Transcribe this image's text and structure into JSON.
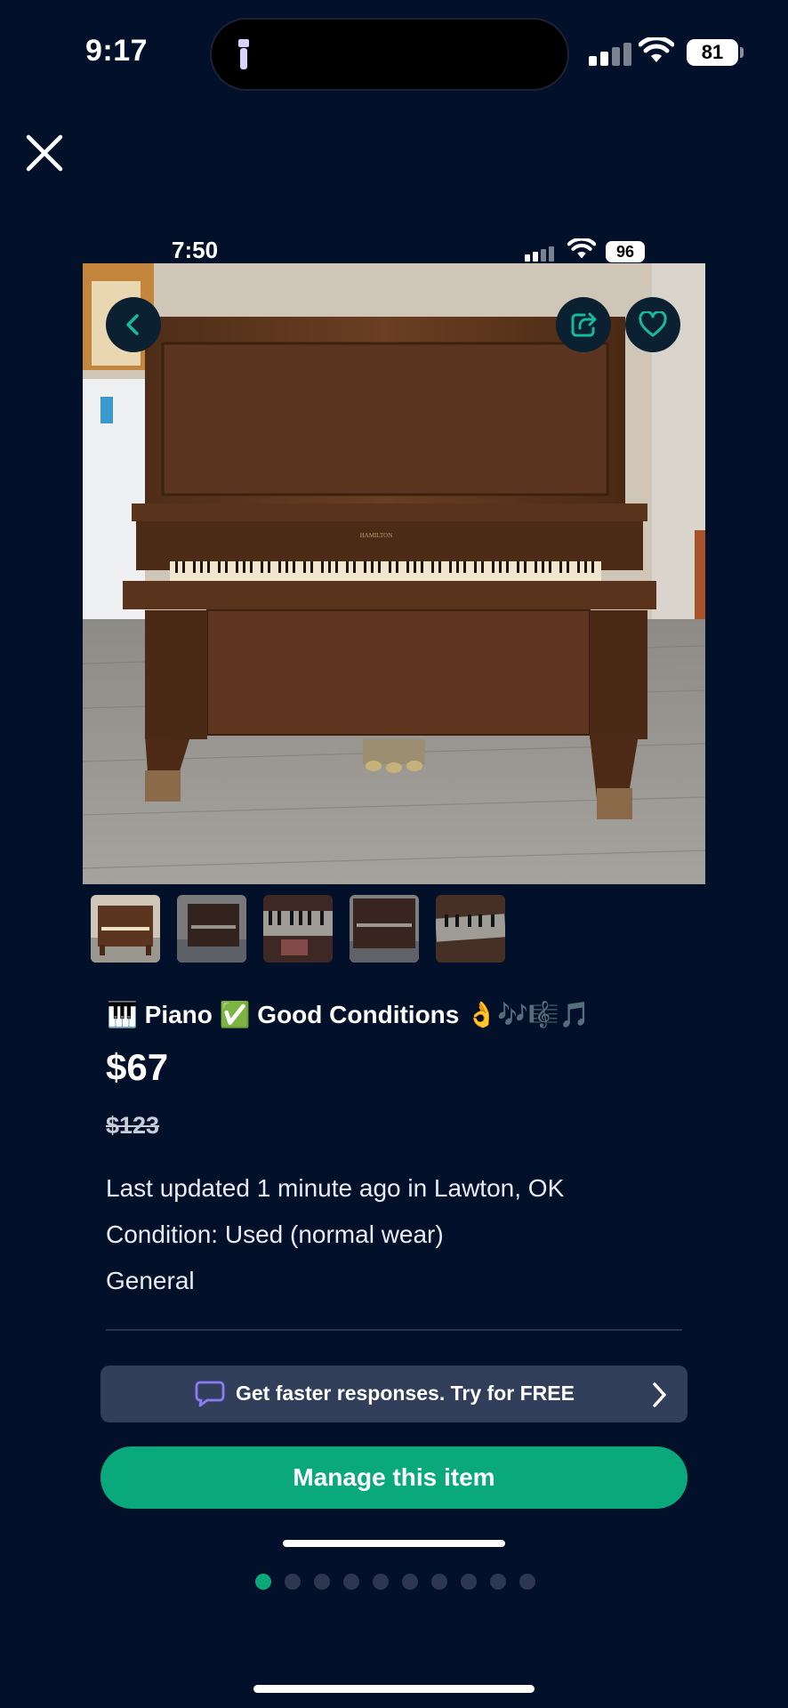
{
  "status_bar": {
    "time": "9:17",
    "battery": "81"
  },
  "screenshot_status_bar": {
    "time": "7:50",
    "battery": "96"
  },
  "icons": {
    "close": "close-icon",
    "back": "chevron-left-icon",
    "share": "share-icon",
    "favorite": "heart-icon",
    "chat": "chat-bubble-icon",
    "next": "chevron-right-icon"
  },
  "listing": {
    "title": "🎹 Piano ✅ Good Conditions 👌🎶🎼🎵",
    "price": "$67",
    "original_price": "$123",
    "updated": "Last updated 1 minute ago in Lawton, OK",
    "condition": "Condition: Used (normal wear)",
    "category": "General",
    "photo_brand": "HAMILTON"
  },
  "thumbnails": {
    "count": 5,
    "selected_index": 0
  },
  "promo": {
    "label": "Get faster responses.  Try for FREE"
  },
  "manage_button": {
    "label": "Manage this item"
  },
  "pagination": {
    "total": 10,
    "active_index": 0
  },
  "colors": {
    "background": "#03102a",
    "accent": "#0aa97b",
    "promo_bg": "#323f5a",
    "chat_icon": "#8b7cf6"
  }
}
